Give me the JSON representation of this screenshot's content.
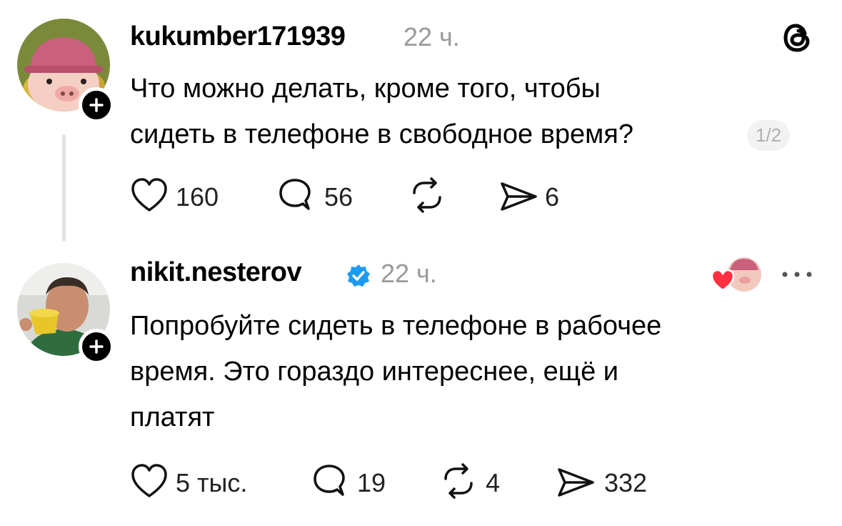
{
  "post": {
    "username": "kukumber171939",
    "time": "22 ч.",
    "text_line1": "Что можно делать, кроме того, чтобы",
    "text_line2": "сидеть в телефоне в свободное время?",
    "page_counter": "1/2",
    "likes": "160",
    "replies": "56",
    "shares": "6"
  },
  "reply": {
    "username": "nikit.nesterov",
    "verified": true,
    "time": "22 ч.",
    "text_line1": "Попробуйте сидеть в телефоне в рабочее",
    "text_line2": "время. Это гораздо интереснее, ещё и",
    "text_line3": "платят",
    "likes": "5 тыс.",
    "replies": "19",
    "reposts": "4",
    "shares": "332"
  },
  "colors": {
    "verified_blue": "#1d9bf0",
    "heart_red": "#ff3040"
  },
  "icons": [
    "threads-logo-icon",
    "heart-icon",
    "comment-icon",
    "repost-icon",
    "send-icon",
    "verified-badge-icon",
    "more-icon"
  ]
}
